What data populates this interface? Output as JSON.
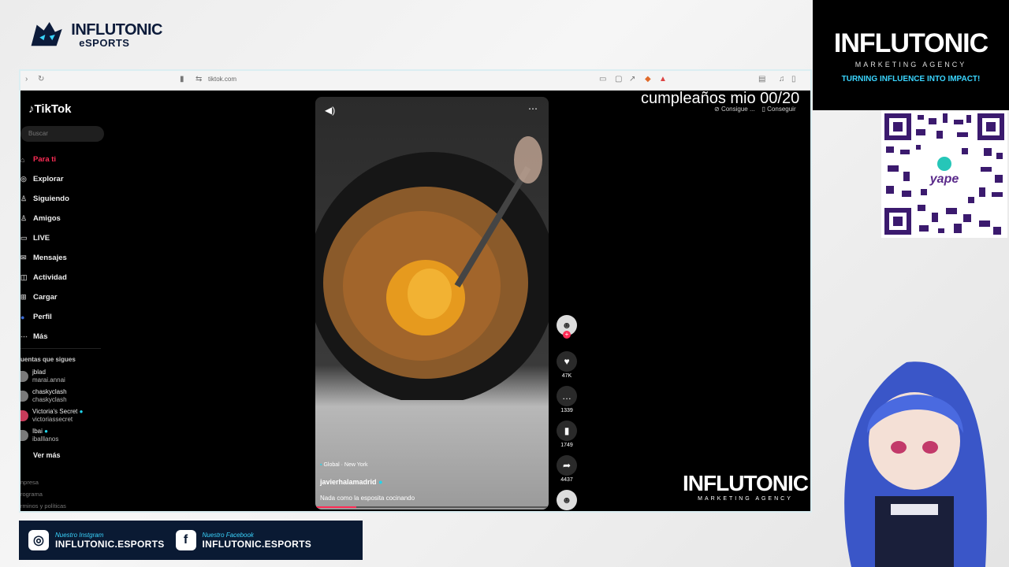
{
  "brand": {
    "line1": "INFLUTONIC",
    "line2": "eSPORTS"
  },
  "agency": {
    "name": "INFLUTONIC",
    "sub": "MARKETING AGENCY",
    "tagline": "TURNING INFLUENCE INTO IMPACT!",
    "accent": "#3ad5ff"
  },
  "qr": {
    "label": "yape"
  },
  "browser": {
    "url": "tiktok.com"
  },
  "tiktok": {
    "logo": "TikTok",
    "search_placeholder": "Buscar",
    "nav": [
      {
        "label": "Para ti",
        "icon": "home-icon"
      },
      {
        "label": "Explorar",
        "icon": "compass-icon"
      },
      {
        "label": "Siguiendo",
        "icon": "following-icon"
      },
      {
        "label": "Amigos",
        "icon": "friends-icon"
      },
      {
        "label": "LIVE",
        "icon": "live-icon"
      },
      {
        "label": "Mensajes",
        "icon": "messages-icon"
      },
      {
        "label": "Actividad",
        "icon": "activity-icon"
      },
      {
        "label": "Cargar",
        "icon": "upload-icon"
      },
      {
        "label": "Perfil",
        "icon": "profile-icon"
      },
      {
        "label": "Más",
        "icon": "more-icon"
      }
    ],
    "following_header": "uentas que sigues",
    "accounts": [
      {
        "name": "jblad",
        "handle": "marai.annai"
      },
      {
        "name": "chaskyclash",
        "handle": "chaskyclash"
      },
      {
        "name": "Victoria's Secret",
        "handle": "victoriassecret"
      },
      {
        "name": "Ibai",
        "handle": "iballlanos"
      }
    ],
    "see_more": "Ver más",
    "footer": [
      "npresa",
      "rograma",
      "rminos y políticas"
    ],
    "overlay_text": "cumpleaños mio 00/20",
    "chips": [
      "Consigue ...",
      "Conseguir"
    ]
  },
  "video": {
    "location": "Global · New York",
    "author": "javierhalamadrid",
    "caption": "Nada como la esposita cocinando"
  },
  "actions": {
    "likes": "47K",
    "comments": "1339",
    "saves": "1749",
    "shares": "4437"
  },
  "overlay_logo": {
    "name": "INFLUTONIC",
    "sub": "MARKETING AGENCY"
  },
  "social": {
    "instagram_title": "Nuestro Instgram",
    "instagram_handle": "INFLUTONIC.ESPORTS",
    "facebook_title": "Nuestro Facebook",
    "facebook_handle": "INFLUTONIC.ESPORTS"
  }
}
